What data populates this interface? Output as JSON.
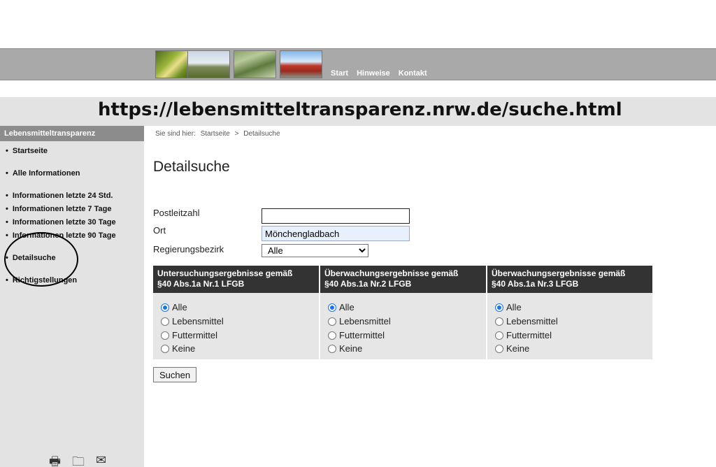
{
  "header": {
    "nav": [
      {
        "label": "Start"
      },
      {
        "label": "Hinweise"
      },
      {
        "label": "Kontakt"
      }
    ]
  },
  "url_annotation": "https://lebensmitteltransparenz.nrw.de/suche.html",
  "sidebar": {
    "title": "Lebensmitteltransparenz",
    "items": [
      {
        "label": "Startseite"
      },
      {
        "label": "Alle Informationen"
      },
      {
        "label": "Informationen letzte 24 Std."
      },
      {
        "label": "Informationen letzte 7 Tage"
      },
      {
        "label": "Informationen letzte 30 Tage"
      },
      {
        "label": "Informationen letzte 90 Tage"
      },
      {
        "label": "Detailsuche"
      },
      {
        "label": "Richtigstellungen"
      }
    ],
    "footer_icons": [
      "printer-icon",
      "folder-icon",
      "mail-icon"
    ]
  },
  "breadcrumb": {
    "prefix": "Sie sind hier:",
    "items": [
      "Startseite",
      ">",
      "Detailsuche"
    ]
  },
  "main": {
    "title": "Detailsuche",
    "fields": {
      "plz_label": "Postleitzahl",
      "plz_value": "",
      "ort_label": "Ort",
      "ort_value": "Mönchengladbach",
      "bezirk_label": "Regierungsbezirk",
      "bezirk_value": "Alle"
    },
    "columns": [
      {
        "title_1": "Untersuchungsergebnisse gemäß",
        "title_2": "§40 Abs.1a Nr.1 LFGB",
        "options": [
          "Alle",
          "Lebensmittel",
          "Futtermittel",
          "Keine"
        ],
        "selected": "Alle"
      },
      {
        "title_1": "Überwachungsergebnisse gemäß",
        "title_2": "§40 Abs.1a Nr.2 LFGB",
        "options": [
          "Alle",
          "Lebensmittel",
          "Futtermittel",
          "Keine"
        ],
        "selected": "Alle"
      },
      {
        "title_1": "Überwachungsergebnisse gemäß",
        "title_2": "§40 Abs.1a Nr.3 LFGB",
        "options": [
          "Alle",
          "Lebensmittel",
          "Futtermittel",
          "Keine"
        ],
        "selected": "Alle"
      }
    ],
    "search_label": "Suchen"
  },
  "colors": {
    "accent": "#1a73e8",
    "header_gray": "#a9a9a9",
    "column_header": "#333333"
  }
}
